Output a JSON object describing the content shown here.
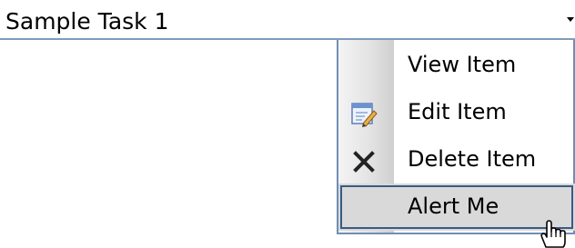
{
  "field": {
    "title": "Sample Task 1"
  },
  "menu": {
    "items": [
      {
        "label": "View Item",
        "icon": "none"
      },
      {
        "label": "Edit Item",
        "icon": "edit-form-icon"
      },
      {
        "label": "Delete Item",
        "icon": "delete-x-icon"
      },
      {
        "label": "Alert Me",
        "icon": "none",
        "state": "hovered"
      }
    ]
  },
  "colors": {
    "menu_border": "#6f8fb4",
    "hover_fill": "#d9d9d9",
    "hover_outline": "#3a5a86"
  }
}
